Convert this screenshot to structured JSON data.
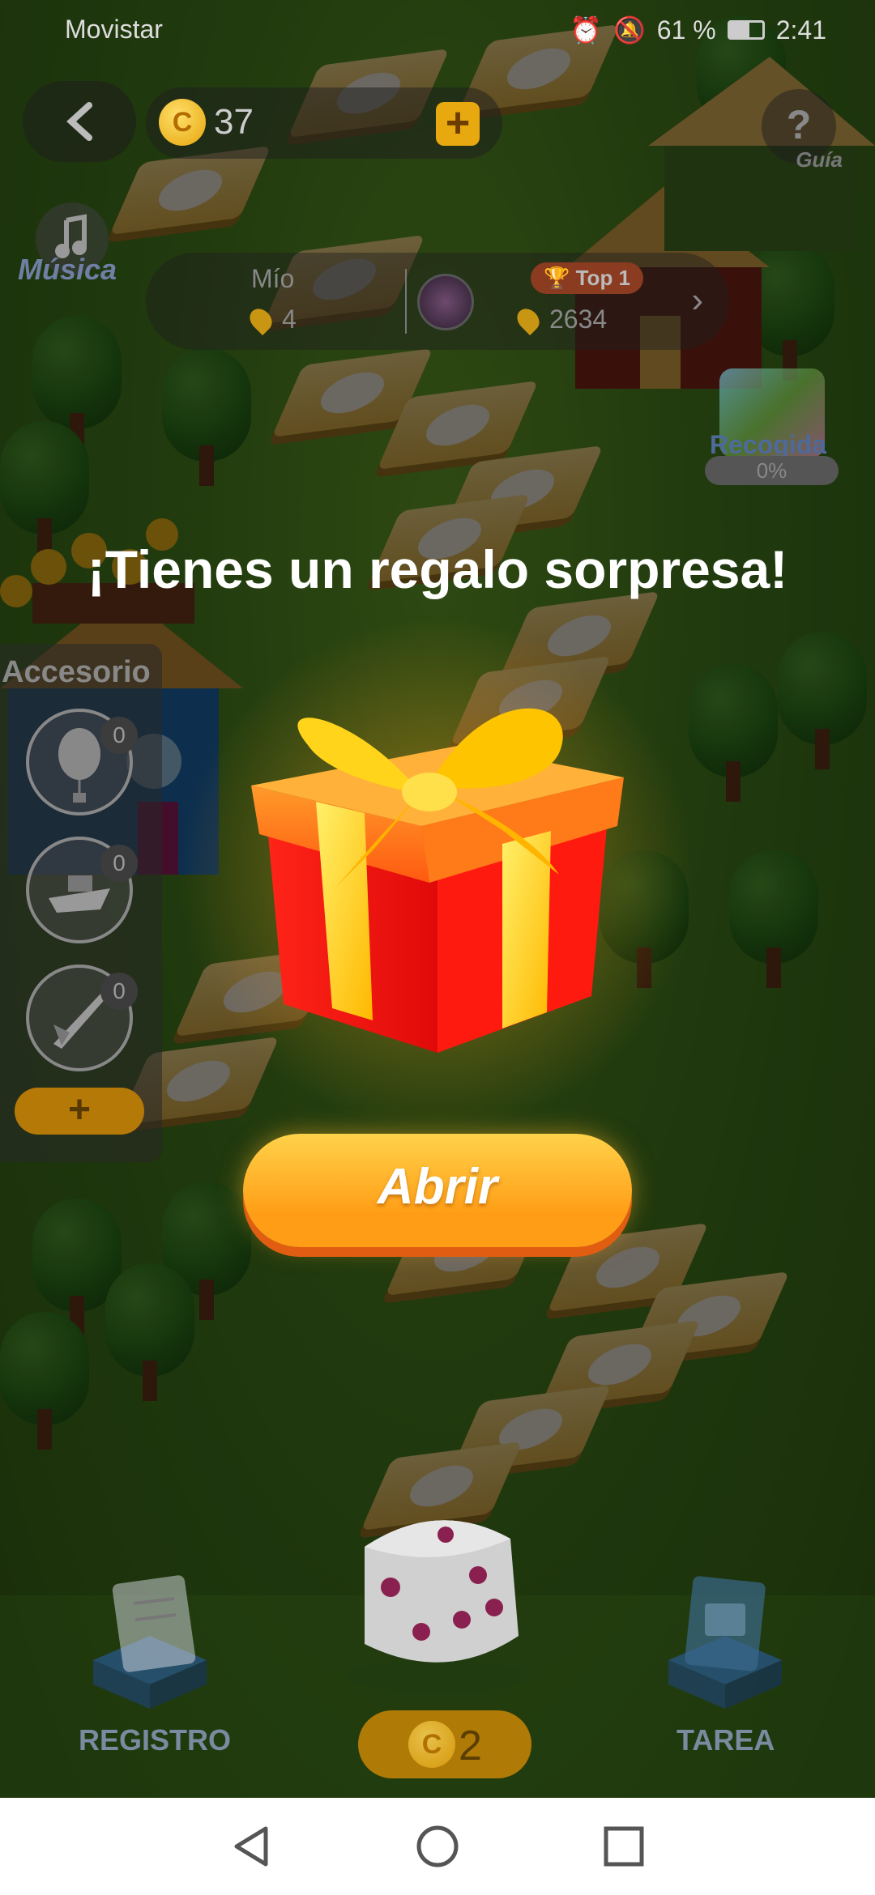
{
  "status_bar": {
    "carrier": "Movistar",
    "battery": "61 %",
    "time": "2:41"
  },
  "hud": {
    "coins": "37",
    "coin_symbol": "C",
    "add_label": "+",
    "help_symbol": "?",
    "help_label": "Guía",
    "music_label": "Música"
  },
  "ranking": {
    "mine_label": "Mío",
    "mine_count": "4",
    "top_label": "Top 1",
    "top_count": "2634"
  },
  "collection": {
    "label": "Recogida",
    "progress": "0%"
  },
  "popup": {
    "headline": "¡Tienes un regalo sorpresa!",
    "open_button": "Abrir"
  },
  "accessories": {
    "title": "Accesorio",
    "items": [
      {
        "icon": "balloon-icon",
        "count": "0"
      },
      {
        "icon": "boat-icon",
        "count": "0"
      },
      {
        "icon": "rocket-icon",
        "count": "0"
      }
    ],
    "add_label": "+"
  },
  "bottom": {
    "registro_label": "REGISTRO",
    "tarea_label": "TAREA",
    "dice_coin_symbol": "C",
    "dice_cost": "2"
  },
  "colors": {
    "accent_orange": "#ff9e16",
    "ribbon_yellow": "#ffd400",
    "gift_red": "#ff1a10"
  }
}
